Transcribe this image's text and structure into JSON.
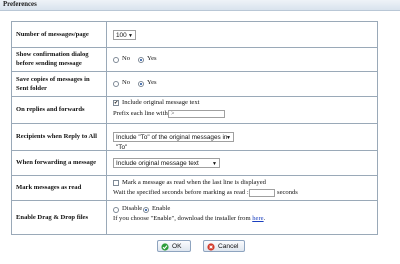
{
  "window": {
    "title": "Preferences"
  },
  "settings": {
    "messages_per_page": {
      "label": "Number of messages/page",
      "value": "100"
    },
    "confirm_send": {
      "label": "Show confirmation dialog before sending message",
      "no": "No",
      "yes": "Yes",
      "selected": "Yes"
    },
    "save_sent": {
      "label": "Save copies of messages in Sent folder",
      "no": "No",
      "yes": "Yes",
      "selected": "Yes"
    },
    "replies_forwards": {
      "label": "On replies and forwards",
      "include_original": "Include original message text",
      "prefix_label": "Prefix each line with :",
      "prefix_value": ">"
    },
    "reply_all": {
      "label": "Recipients when Reply to All",
      "value": "Include \"To\" of the original messages in \"To\""
    },
    "forwarding": {
      "label": "When forwarding a message",
      "value": "Include original message text"
    },
    "mark_read": {
      "label": "Mark messages as read",
      "option": "Mark a message as read when the last line is displayed",
      "wait_text": "Wait the specified seconds before marking as read :",
      "seconds_label": "seconds",
      "seconds_value": ""
    },
    "drag_drop": {
      "label": "Enable Drag & Drop files",
      "disable": "Disable",
      "enable": "Enable",
      "selected": "Enable",
      "note_prefix": "If you choose \"Enable\", download the installer from",
      "link": "here",
      "note_suffix": "."
    }
  },
  "buttons": {
    "ok": "OK",
    "cancel": "Cancel"
  },
  "colors": {
    "ok_icon": "#2e9e3a",
    "cancel_icon": "#d23a2a",
    "link": "#1a3fbf"
  }
}
